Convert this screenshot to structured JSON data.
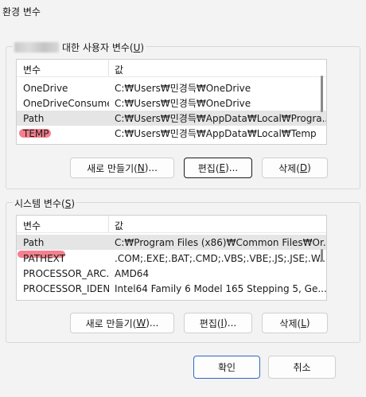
{
  "window": {
    "title": "환경 변수"
  },
  "user_section": {
    "label_prefix": "대한 사용자 변수(",
    "label_key": "U",
    "label_suffix": ")",
    "columns": [
      "변수",
      "값"
    ],
    "rows": [
      {
        "name": "OneDrive",
        "value": "C:₩Users₩민경득₩OneDrive",
        "selected": false
      },
      {
        "name": "OneDriveConsumer",
        "value": "C:₩Users₩민경득₩OneDrive",
        "selected": false
      },
      {
        "name": "Path",
        "value": "C:₩Users₩민경득₩AppData₩Local₩Progra...",
        "selected": true
      },
      {
        "name": "TEMP",
        "value": "C:₩Users₩민경득₩AppData₩Local₩Temp",
        "selected": false
      }
    ],
    "buttons": {
      "new": {
        "prefix": "새로 만들기(",
        "key": "N",
        "suffix": ")..."
      },
      "edit": {
        "prefix": "편집(",
        "key": "E",
        "suffix": ")..."
      },
      "delete": {
        "prefix": "삭제(",
        "key": "D",
        "suffix": ")"
      }
    }
  },
  "system_section": {
    "label_prefix": "시스템 변수(",
    "label_key": "S",
    "label_suffix": ")",
    "columns": [
      "변수",
      "값"
    ],
    "rows": [
      {
        "name": "Path",
        "value": "C:₩Program Files (x86)₩Common Files₩Or...",
        "selected": true
      },
      {
        "name": "PATHEXT",
        "value": ".COM;.EXE;.BAT;.CMD;.VBS;.VBE;.JS;.JSE;.W...",
        "selected": false
      },
      {
        "name": "PROCESSOR_ARC...",
        "value": "AMD64",
        "selected": false
      },
      {
        "name": "PROCESSOR_IDEN...",
        "value": "Intel64 Family 6 Model 165 Stepping 5, Ge...",
        "selected": false
      }
    ],
    "buttons": {
      "new": {
        "prefix": "새로 만들기(",
        "key": "W",
        "suffix": ")..."
      },
      "edit": {
        "prefix": "편집(",
        "key": "I",
        "suffix": ")..."
      },
      "delete": {
        "prefix": "삭제(",
        "key": "L",
        "suffix": ")"
      }
    }
  },
  "footer": {
    "ok": "확인",
    "cancel": "취소"
  },
  "colors": {
    "accent": "#2f68c4",
    "highlight_mark": "#f26a7a",
    "selected_row": "#e5e5e5"
  }
}
